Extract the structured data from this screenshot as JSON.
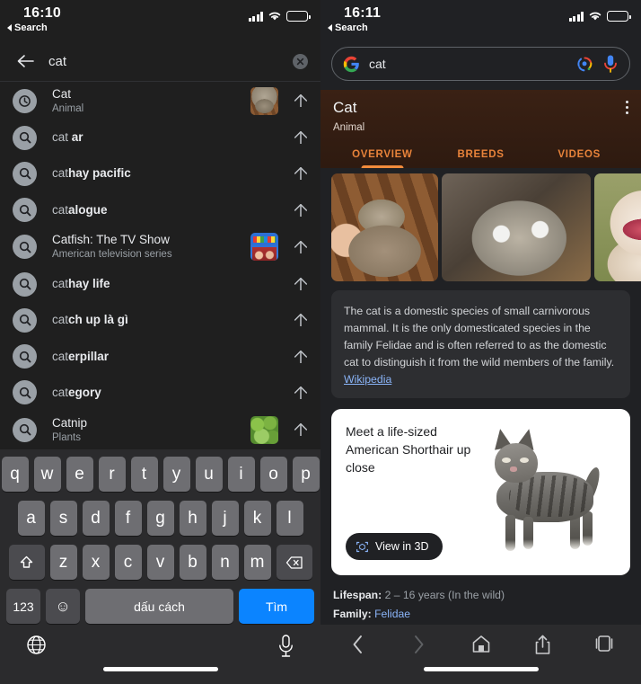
{
  "left": {
    "status": {
      "time": "16:10",
      "back_label": "Search",
      "signal_icon": "cellular-signal-icon",
      "wifi_icon": "wifi-icon",
      "battery_icon": "battery-icon"
    },
    "search": {
      "back_icon": "back-arrow-icon",
      "query": "cat",
      "clear_icon": "clear-circle-icon"
    },
    "suggestions": [
      {
        "title": "Cat",
        "typed": "",
        "rest": "Cat",
        "subtitle": "Animal",
        "icon": "history-clock-icon",
        "thumb": "cat-photo-thumbnail",
        "thumb_class": "thumb-cat1",
        "arrow": "insert-arrow-icon",
        "entity": true
      },
      {
        "title": "cat ar",
        "typed": "cat ",
        "rest": "ar",
        "subtitle": "",
        "icon": "search-icon",
        "thumb": "",
        "thumb_class": "",
        "arrow": "insert-arrow-icon",
        "entity": false
      },
      {
        "title": "cathay pacific",
        "typed": "cat",
        "rest": "hay pacific",
        "subtitle": "",
        "icon": "search-icon",
        "thumb": "",
        "thumb_class": "",
        "arrow": "insert-arrow-icon",
        "entity": false
      },
      {
        "title": "catalogue",
        "typed": "cat",
        "rest": "alogue",
        "subtitle": "",
        "icon": "search-icon",
        "thumb": "",
        "thumb_class": "",
        "arrow": "insert-arrow-icon",
        "entity": false
      },
      {
        "title": "Catfish: The TV Show",
        "typed": "",
        "rest": "Catfish: The TV Show",
        "subtitle": "American television series",
        "icon": "search-icon",
        "thumb": "catfish-show-thumbnail",
        "thumb_class": "thumb-catfish",
        "arrow": "insert-arrow-icon",
        "entity": true
      },
      {
        "title": "cathay life",
        "typed": "cat",
        "rest": "hay life",
        "subtitle": "",
        "icon": "search-icon",
        "thumb": "",
        "thumb_class": "",
        "arrow": "insert-arrow-icon",
        "entity": false
      },
      {
        "title": "catch up là gì",
        "typed": "cat",
        "rest": "ch up là gì",
        "subtitle": "",
        "icon": "search-icon",
        "thumb": "",
        "thumb_class": "",
        "arrow": "insert-arrow-icon",
        "entity": false
      },
      {
        "title": "caterpillar",
        "typed": "cat",
        "rest": "erpillar",
        "subtitle": "",
        "icon": "search-icon",
        "thumb": "",
        "thumb_class": "",
        "arrow": "insert-arrow-icon",
        "entity": false
      },
      {
        "title": "category",
        "typed": "cat",
        "rest": "egory",
        "subtitle": "",
        "icon": "search-icon",
        "thumb": "",
        "thumb_class": "",
        "arrow": "insert-arrow-icon",
        "entity": false
      },
      {
        "title": "Catnip",
        "typed": "",
        "rest": "Catnip",
        "subtitle": "Plants",
        "icon": "search-icon",
        "thumb": "catnip-plant-thumbnail",
        "thumb_class": "thumb-catnip",
        "arrow": "insert-arrow-icon",
        "entity": true
      }
    ],
    "keyboard": {
      "row1": [
        "q",
        "w",
        "e",
        "r",
        "t",
        "y",
        "u",
        "i",
        "o",
        "p"
      ],
      "row2": [
        "a",
        "s",
        "d",
        "f",
        "g",
        "h",
        "j",
        "k",
        "l"
      ],
      "row3": [
        "z",
        "x",
        "c",
        "v",
        "b",
        "n",
        "m"
      ],
      "shift_icon": "shift-arrow-icon",
      "backspace_icon": "backspace-icon",
      "numbers_label": "123",
      "emoji_icon": "emoji-smiley-icon",
      "space_label": "dấu cách",
      "go_label": "Tìm",
      "globe_icon": "globe-language-icon",
      "dictation_icon": "microphone-icon"
    }
  },
  "right": {
    "status": {
      "time": "16:11",
      "back_label": "Search",
      "signal_icon": "cellular-signal-icon",
      "wifi_icon": "wifi-icon",
      "battery_icon": "battery-icon"
    },
    "searchbar": {
      "google_icon": "google-g-logo-icon",
      "query": "cat",
      "lens_icon": "google-lens-icon",
      "mic_icon": "microphone-icon"
    },
    "knowledge_panel": {
      "title": "Cat",
      "subtitle": "Animal",
      "menu_icon": "overflow-menu-icon",
      "accent_color": "#f28b3c",
      "header_bg": "#3a2114",
      "tabs": [
        {
          "label": "OVERVIEW",
          "active": true
        },
        {
          "label": "BREEDS",
          "active": false
        },
        {
          "label": "VIDEOS",
          "active": false
        }
      ],
      "carousel": [
        {
          "alt": "tabby-cat-on-bench-photo"
        },
        {
          "alt": "kitten-closeup-photo"
        },
        {
          "alt": "yawning-kitten-photo"
        }
      ],
      "description": {
        "text": "The cat is a domestic species of small carnivorous mammal. It is the only domesticated species in the family Felidae and is often referred to as the domestic cat to distinguish it from the wild members of the family.",
        "source": "Wikipedia",
        "link_color": "#8ab4f8"
      },
      "card_3d": {
        "title": "Meet a life-sized American Shorthair up close",
        "button_label": "View in 3D",
        "button_icon": "ar-cube-icon",
        "model_alt": "american-shorthair-3d-model"
      },
      "facts": [
        {
          "label": "Lifespan:",
          "value": "2 – 16 years (In the wild)",
          "is_link": false
        },
        {
          "label": "Family:",
          "value": "Felidae",
          "is_link": true
        }
      ]
    },
    "toolbar": {
      "back_icon": "chevron-left-icon",
      "forward_icon": "chevron-right-icon",
      "home_icon": "home-icon",
      "share_icon": "share-icon",
      "tabs_icon": "tabs-icon"
    }
  }
}
